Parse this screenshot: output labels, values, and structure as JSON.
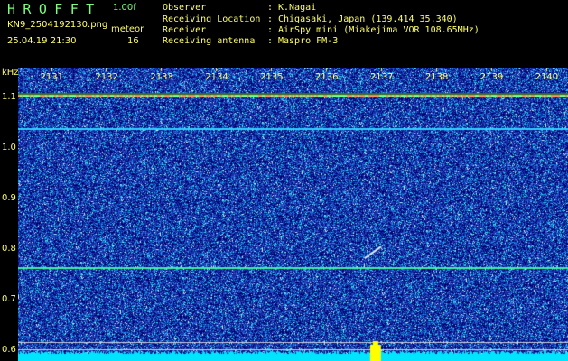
{
  "app": {
    "logo": "HROFFT",
    "version": "1.00f",
    "filename": "KN9_2504192130.png",
    "mode": "meteor",
    "datetime": "25.04.19 21:30",
    "count": "16"
  },
  "info": [
    {
      "key": "Observer",
      "value": "K.Nagai"
    },
    {
      "key": "Receiving Location",
      "value": "Chigasaki, Japan (139.414 35.340)"
    },
    {
      "key": "Receiver",
      "value": "AirSpy mini (Miakejima VOR 108.65MHz)"
    },
    {
      "key": "Receiving antenna",
      "value": "Maspro FM-3"
    }
  ],
  "colors": {
    "background": "#000000",
    "label": "#ffff66",
    "logo": "#7dfc7d",
    "spectrogram_base": "#1a2a9a",
    "noise_floor": "#00e5ff",
    "echo": "#ffff00"
  },
  "chart_data": {
    "type": "heatmap",
    "ylabel": "kHz",
    "y_ticks": [
      "1.1",
      "1.0",
      "0.9",
      "0.8",
      "0.7",
      "0.6"
    ],
    "x_ticks": [
      "2131",
      "2132",
      "2133",
      "2134",
      "2135",
      "2136",
      "2137",
      "2138",
      "2139",
      "2140"
    ],
    "ylim": [
      0.58,
      1.16
    ],
    "xlim": [
      2130.4,
      2140.4
    ],
    "horizontal_lines_khz": [
      1.105,
      1.04,
      0.766,
      0.618,
      0.604
    ],
    "meteor_echo": {
      "x_start": 2136.7,
      "x_end": 2137.0,
      "y_start": 0.783,
      "y_end": 0.806
    },
    "burst_x": 2136.9
  }
}
